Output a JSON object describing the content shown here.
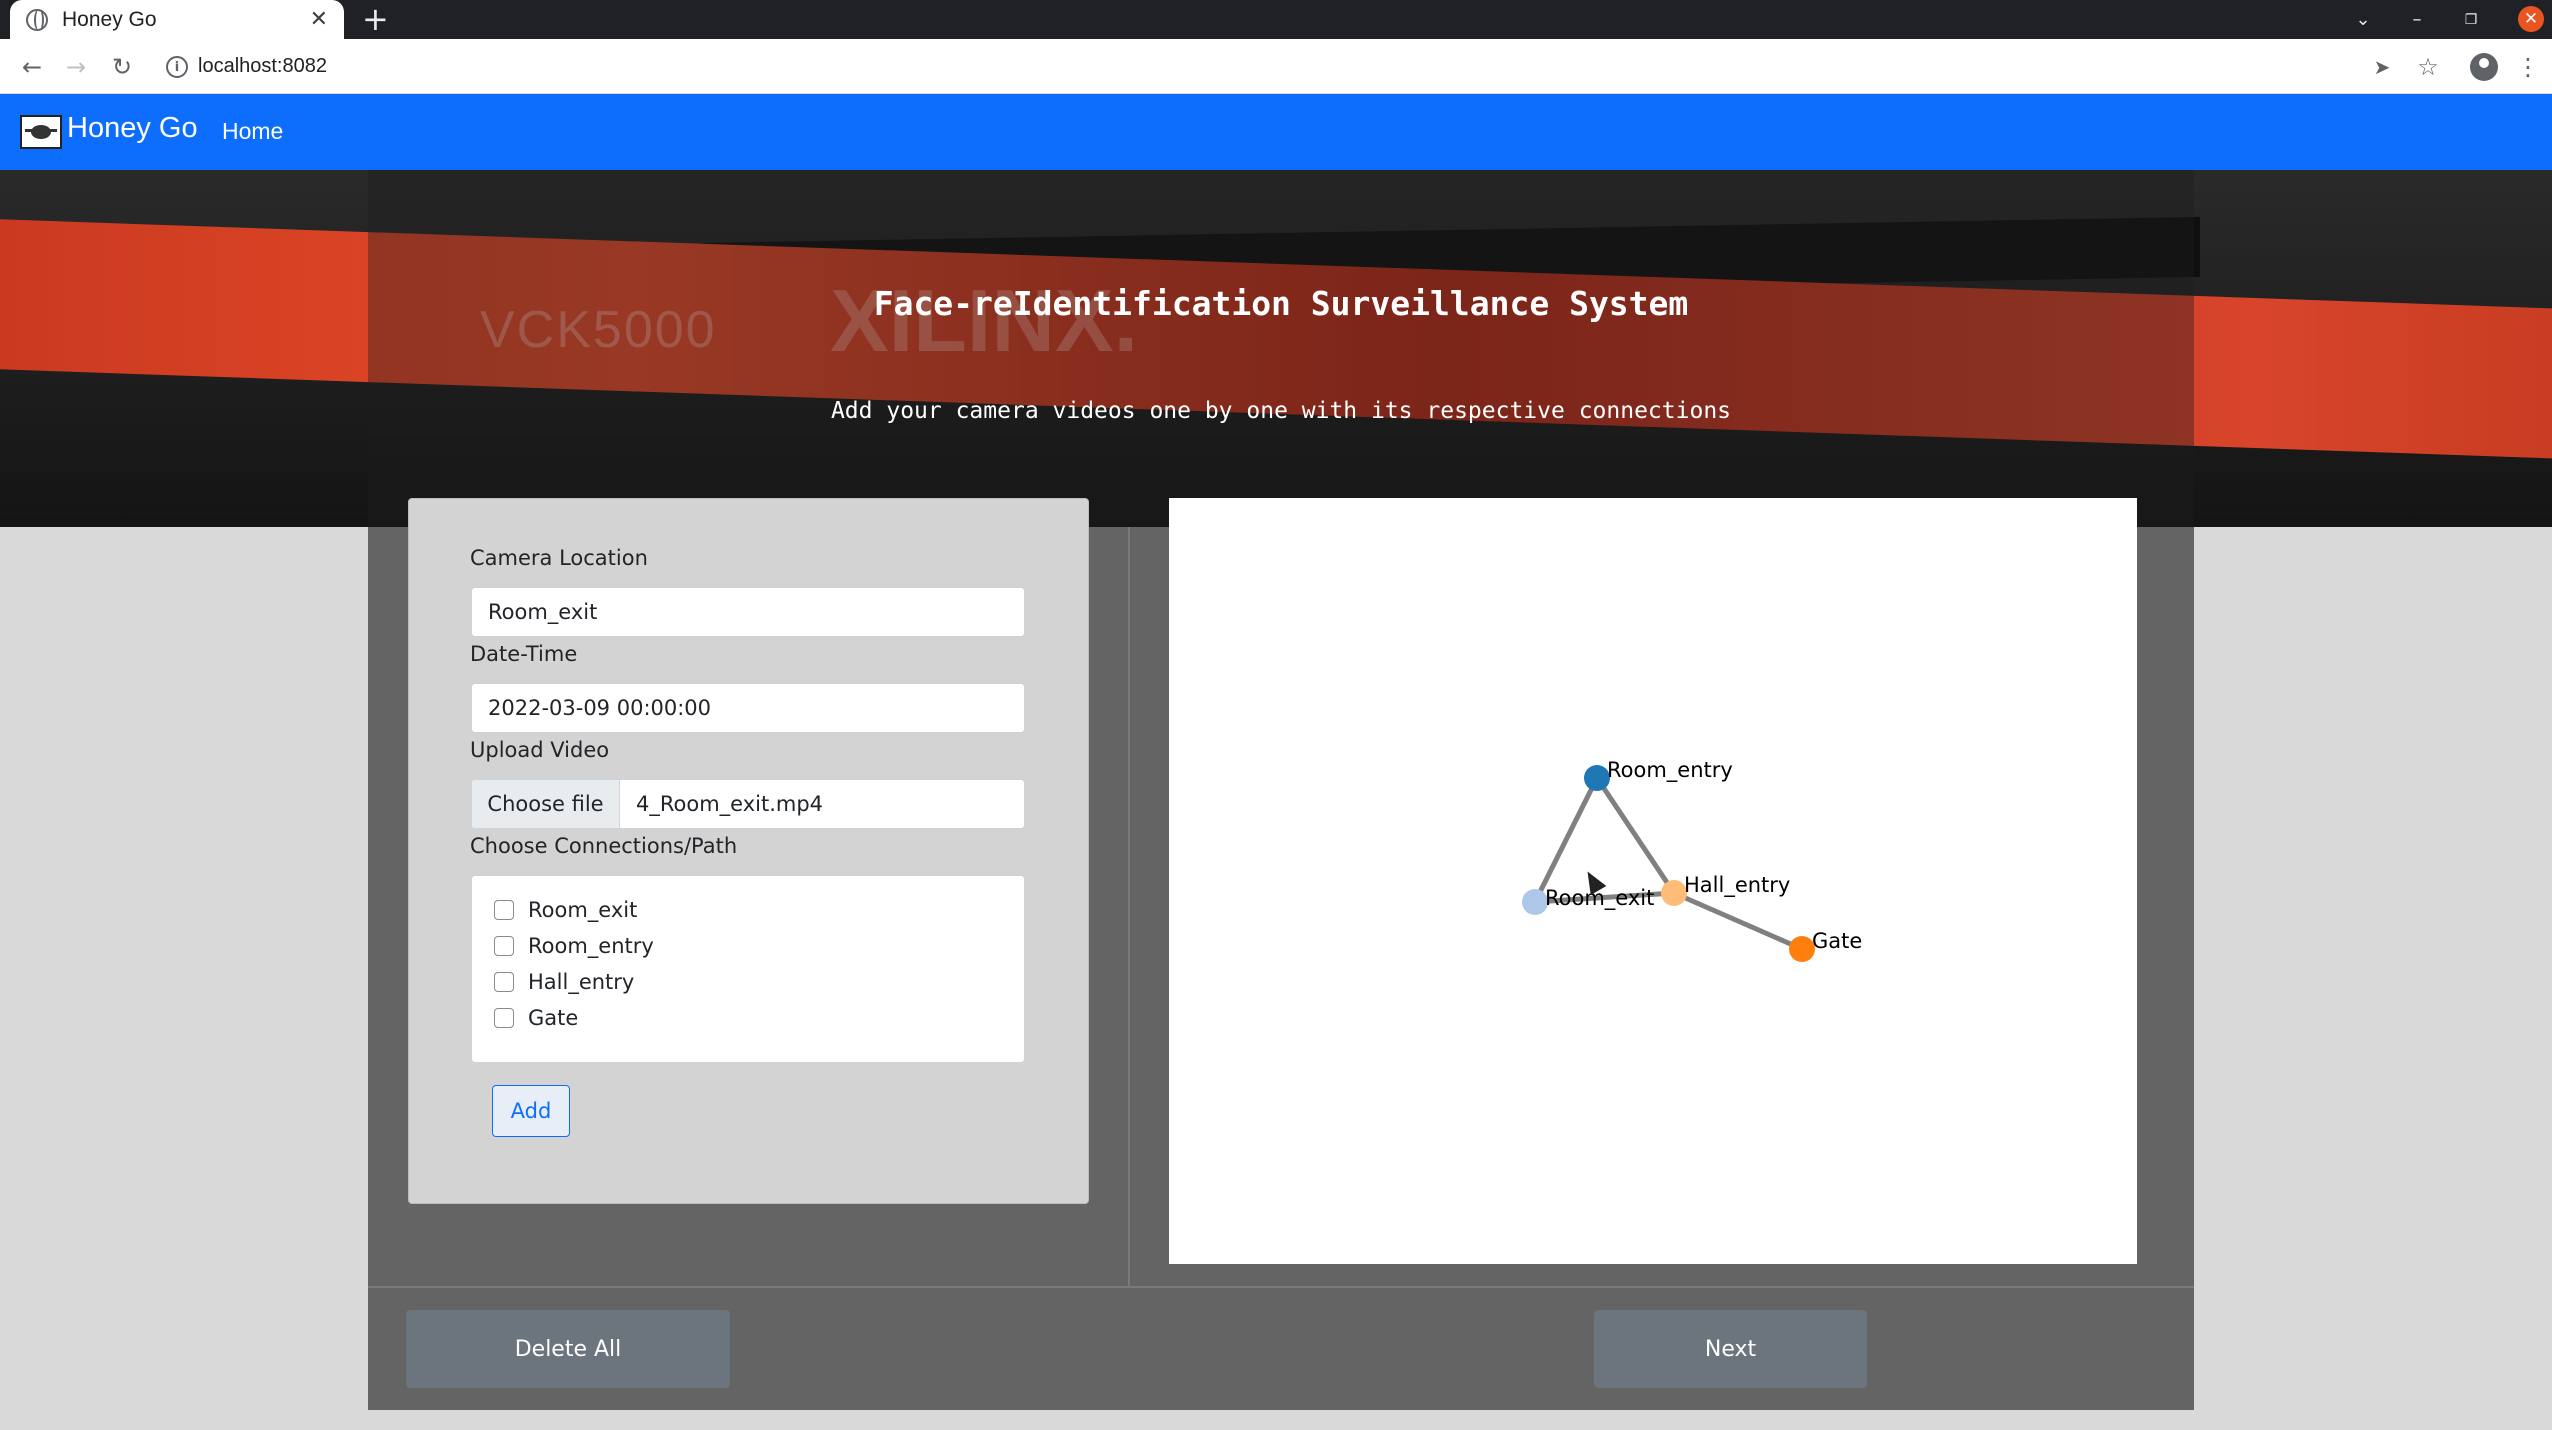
{
  "browser": {
    "tab_title": "Honey Go",
    "tab_close": "✕",
    "new_tab": "+",
    "url": "localhost:8082"
  },
  "navbar": {
    "brand": "Honey Go",
    "home_link": "Home",
    "color": "#0d6efd"
  },
  "hero": {
    "engraving_model": "VCK5000",
    "engraving_brand": "XILINX.",
    "title": "Face-reIdentification Surveillance System",
    "subtitle": "Add your camera videos one by one with its respective connections"
  },
  "form": {
    "camera_location_label": "Camera Location",
    "camera_location_value": "Room_exit",
    "datetime_label": "Date-Time",
    "datetime_value": "2022-03-09 00:00:00",
    "upload_label": "Upload Video",
    "choose_file_label": "Choose file",
    "file_name": "4_Room_exit.mp4",
    "connections_label": "Choose Connections/Path",
    "connections": [
      {
        "label": "Room_exit",
        "checked": false
      },
      {
        "label": "Room_entry",
        "checked": false
      },
      {
        "label": "Hall_entry",
        "checked": false
      },
      {
        "label": "Gate",
        "checked": false
      }
    ],
    "add_button": "Add"
  },
  "graph": {
    "nodes": [
      {
        "name": "Room_entry",
        "color": "#1f77b4"
      },
      {
        "name": "Room_exit",
        "color": "#aec7e8"
      },
      {
        "name": "Hall_entry",
        "color": "#ffbb78"
      },
      {
        "name": "Gate",
        "color": "#ff7f0e"
      }
    ],
    "edges": [
      [
        "Room_entry",
        "Room_exit"
      ],
      [
        "Room_entry",
        "Hall_entry"
      ],
      [
        "Room_exit",
        "Hall_entry"
      ],
      [
        "Hall_entry",
        "Gate"
      ]
    ],
    "edge_color": "#808080"
  },
  "footer": {
    "delete_all": "Delete All",
    "next": "Next"
  }
}
